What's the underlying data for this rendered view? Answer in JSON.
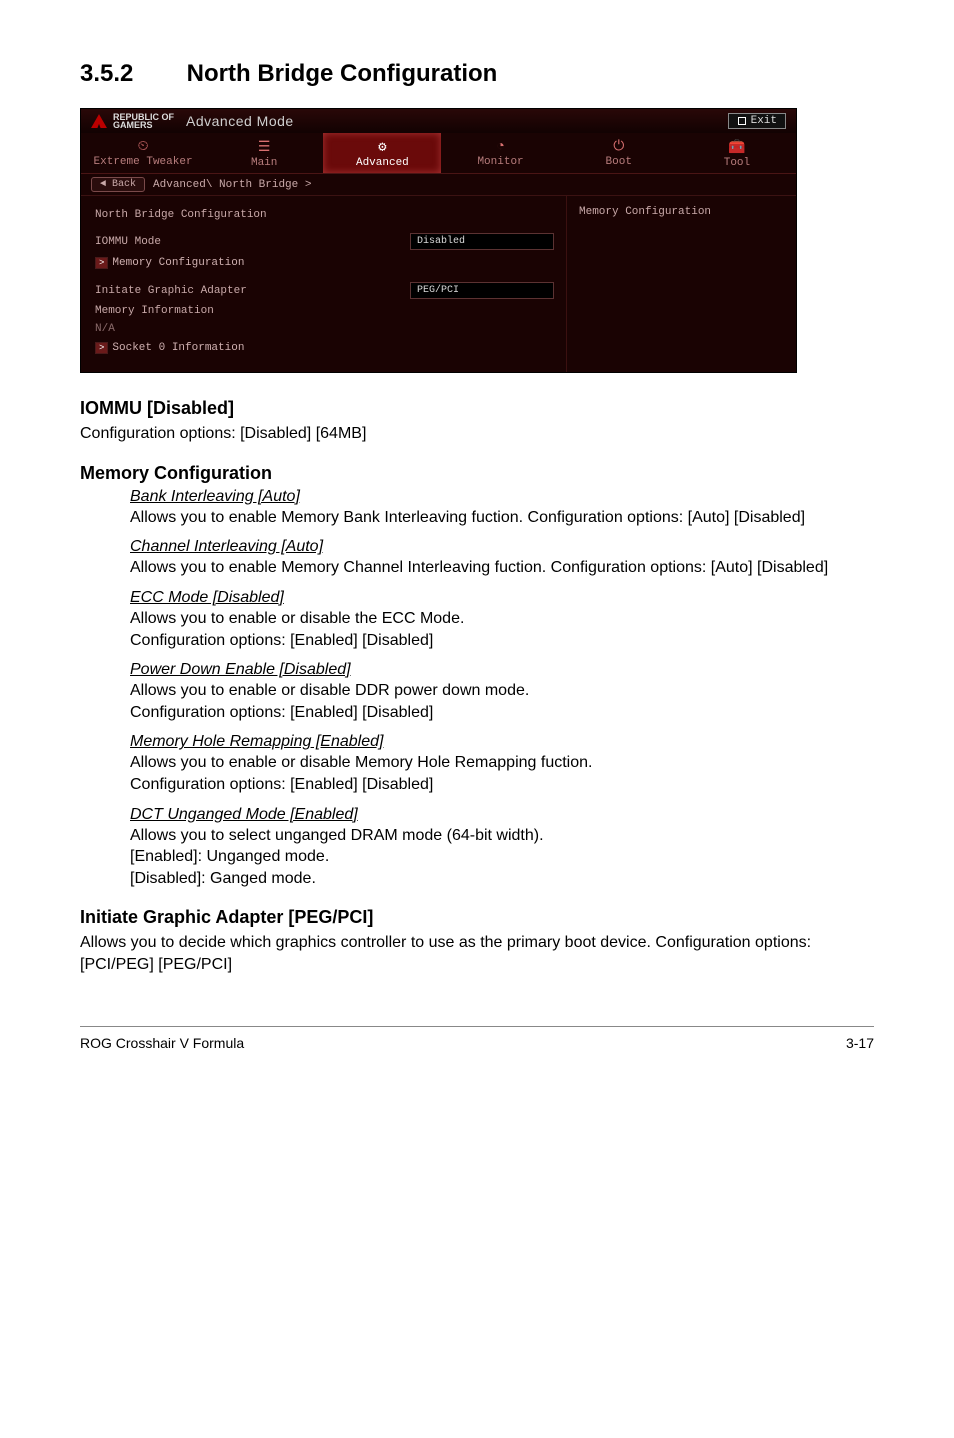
{
  "section": {
    "number": "3.5.2",
    "title": "North Bridge Configuration"
  },
  "bios": {
    "brand_top": "REPUBLIC OF",
    "brand_bottom": "GAMERS",
    "mode": "Advanced Mode",
    "exit": "Exit",
    "tabs": {
      "extreme": "Extreme Tweaker",
      "main": "Main",
      "advanced": "Advanced",
      "monitor": "Monitor",
      "boot": "Boot",
      "tool": "Tool"
    },
    "back": "Back",
    "breadcrumb": "Advanced\\ North Bridge >",
    "left": {
      "heading": "North Bridge Configuration",
      "iommu_label": "IOMMU Mode",
      "iommu_value": "Disabled",
      "mem_cfg": "Memory Configuration",
      "initiate_label": "Initate Graphic Adapter",
      "initiate_value": "PEG/PCI",
      "mem_info": "Memory Information",
      "na": "N/A",
      "socket": "Socket 0 Information"
    },
    "right": {
      "help": "Memory Configuration"
    }
  },
  "doc": {
    "iommu_h": "IOMMU [Disabled]",
    "iommu_p": "Configuration options: [Disabled] [64MB]",
    "memcfg_h": "Memory Configuration",
    "opts": {
      "bank_t": "Bank Interleaving [Auto]",
      "bank_b": "Allows you to enable Memory Bank Interleaving fuction. Configuration options: [Auto] [Disabled]",
      "chan_t": "Channel Interleaving [Auto]",
      "chan_b": "Allows you to enable Memory Channel Interleaving fuction. Configuration options: [Auto] [Disabled]",
      "ecc_t": "ECC Mode [Disabled]",
      "ecc_b1": "Allows you to enable or disable the ECC Mode.",
      "ecc_b2": "Configuration options: [Enabled] [Disabled]",
      "pdn_t": "Power Down Enable [Disabled]",
      "pdn_b1": "Allows you to enable or disable DDR power down mode.",
      "pdn_b2": "Configuration options: [Enabled] [Disabled]",
      "mhr_t": "Memory Hole Remapping [Enabled]",
      "mhr_b1": "Allows you to enable or disable Memory Hole Remapping fuction.",
      "mhr_b2": "Configuration options: [Enabled] [Disabled]",
      "dct_t": "DCT Unganged Mode [Enabled]",
      "dct_b1": "Allows you to select unganged DRAM mode (64-bit width).",
      "dct_b2": "[Enabled]: Unganged mode.",
      "dct_b3": "[Disabled]: Ganged mode."
    },
    "init_h": "Initiate Graphic Adapter [PEG/PCI]",
    "init_p": "Allows you to decide which graphics controller to use as the primary boot device. Configuration options: [PCI/PEG] [PEG/PCI]"
  },
  "footer": {
    "left": "ROG Crosshair V Formula",
    "right": "3-17"
  }
}
